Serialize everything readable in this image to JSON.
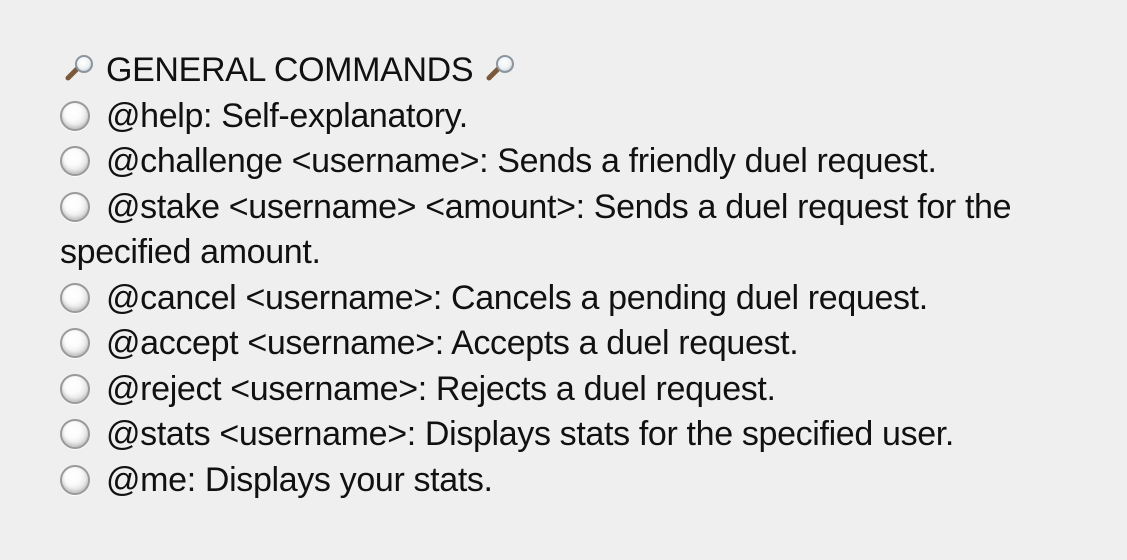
{
  "heading": {
    "icon_left": "magnifying-glass-icon",
    "text": "GENERAL COMMANDS",
    "icon_right": "magnifying-glass-icon"
  },
  "commands": [
    {
      "icon": "radio-button-icon",
      "command": "@help",
      "text": ": Self-explanatory."
    },
    {
      "icon": "radio-button-icon",
      "command": "@challenge <username>",
      "text": ": Sends a friendly duel request."
    },
    {
      "icon": "radio-button-icon",
      "command": "@stake <username> <amount>",
      "text": ": Sends a duel request for the specified amount."
    },
    {
      "icon": "radio-button-icon",
      "command": "@cancel <username>",
      "text": ": Cancels a pending duel request."
    },
    {
      "icon": "radio-button-icon",
      "command": "@accept <username>",
      "text": ": Accepts a duel request."
    },
    {
      "icon": "radio-button-icon",
      "command": "@reject <username>",
      "text": ": Rejects a duel request."
    },
    {
      "icon": "radio-button-icon",
      "command": "@stats <username>",
      "text": ": Displays stats for the specified user."
    },
    {
      "icon": "radio-button-icon",
      "command": "@me",
      "text": ": Displays your stats."
    }
  ],
  "colors": {
    "background": "#efeff0",
    "text": "#111111",
    "icon_gray": "#9a9a9a"
  }
}
